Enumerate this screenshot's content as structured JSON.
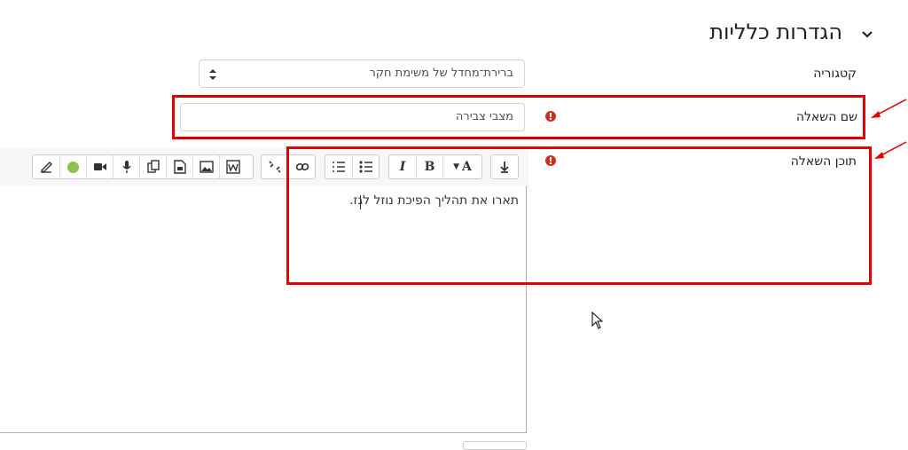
{
  "section": {
    "title": "הגדרות כלליות"
  },
  "fields": {
    "category": {
      "label": "קטגוריה",
      "value": "ברירת־מחדל של משימת חקר"
    },
    "question_name": {
      "label": "שם השאלה",
      "value": "מצבי צבירה"
    },
    "question_text": {
      "label": "תוכן השאלה",
      "content": "תארו את תהליך הפיכת נוזל לגז."
    }
  },
  "toolbar": {
    "icons": [
      "collapse-icon",
      "font-color-icon",
      "bold-icon",
      "italic-icon",
      "bullet-list-icon",
      "numbered-list-icon",
      "link-icon",
      "unlink-icon",
      "word-paste-icon",
      "image-icon",
      "media-icon",
      "copy-icon",
      "microphone-icon",
      "video-icon",
      "emoji-icon",
      "accessibility-icon"
    ],
    "bold": "B",
    "italic": "I",
    "font_color": "A"
  },
  "colors": {
    "highlight": "#e00000",
    "required": "#ca3120",
    "emoji": "#8bc34a"
  }
}
